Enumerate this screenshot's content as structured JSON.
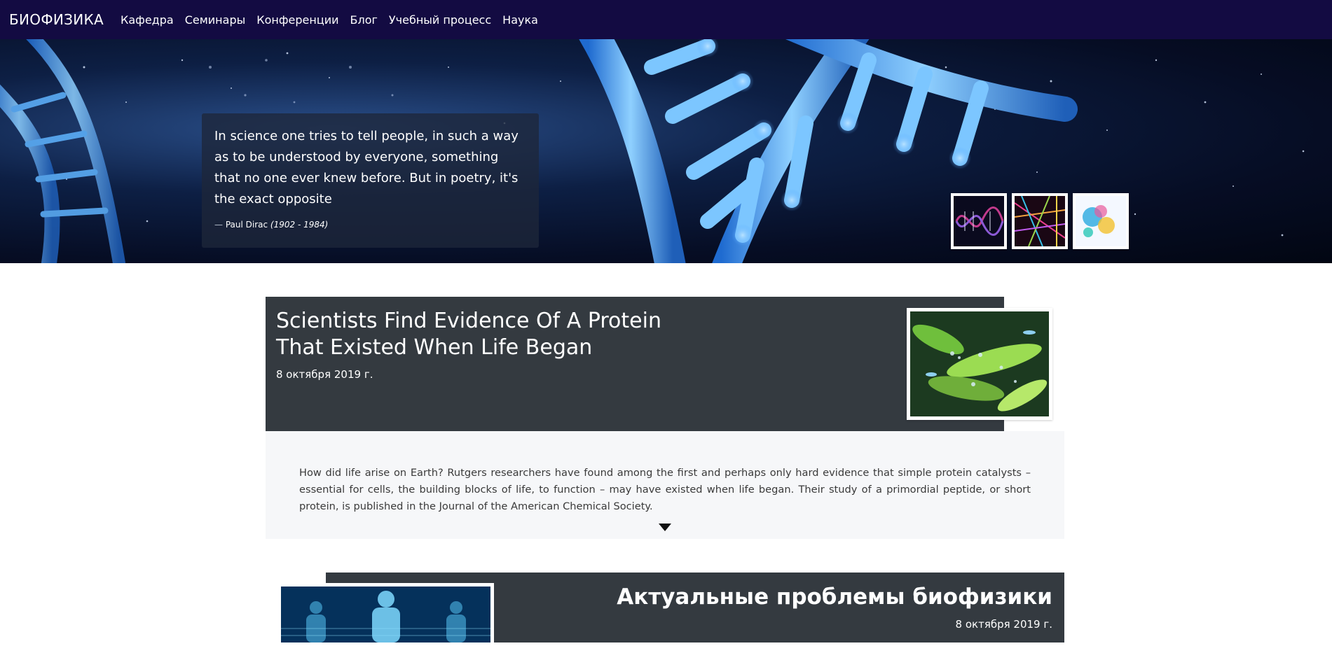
{
  "navbar": {
    "brand": "БИОФИЗИКА",
    "links": [
      "Кафедра",
      "Семинары",
      "Конференции",
      "Блог",
      "Учебный процесс",
      "Наука"
    ]
  },
  "hero": {
    "quote": "In science one tries to tell people, in such a way as to be understood by everyone, something that no one ever knew before. But in poetry, it's the exact opposite",
    "author_dash": "—",
    "author_name": "Paul Dirac",
    "author_years": "(1902 - 1984)",
    "thumbnails": [
      "dna-wave-thumbnail",
      "neon-lines-thumbnail",
      "paint-splash-thumbnail"
    ]
  },
  "articles": [
    {
      "title": "Scientists Find Evidence Of A Protein That Existed When Life Began",
      "date": "8 октября 2019 г.",
      "excerpt": "How did life arise on Earth? Rutgers researchers have found among the first and perhaps only hard evidence that simple protein catalysts – essential for cells, the building blocks of life, to function – may have existed when life began. Their study of a primordial peptide, or short protein, is published in the Journal of the American Chemical Society.",
      "image": "bacteria-image"
    },
    {
      "title": "Актуальные проблемы биофизики",
      "date": "8 октября 2019 г.",
      "image": "digital-human-image"
    }
  ],
  "colors": {
    "navbar_bg": "#130b42",
    "article_header_bg": "#343a40",
    "article_body_bg": "#f6f7f9"
  }
}
